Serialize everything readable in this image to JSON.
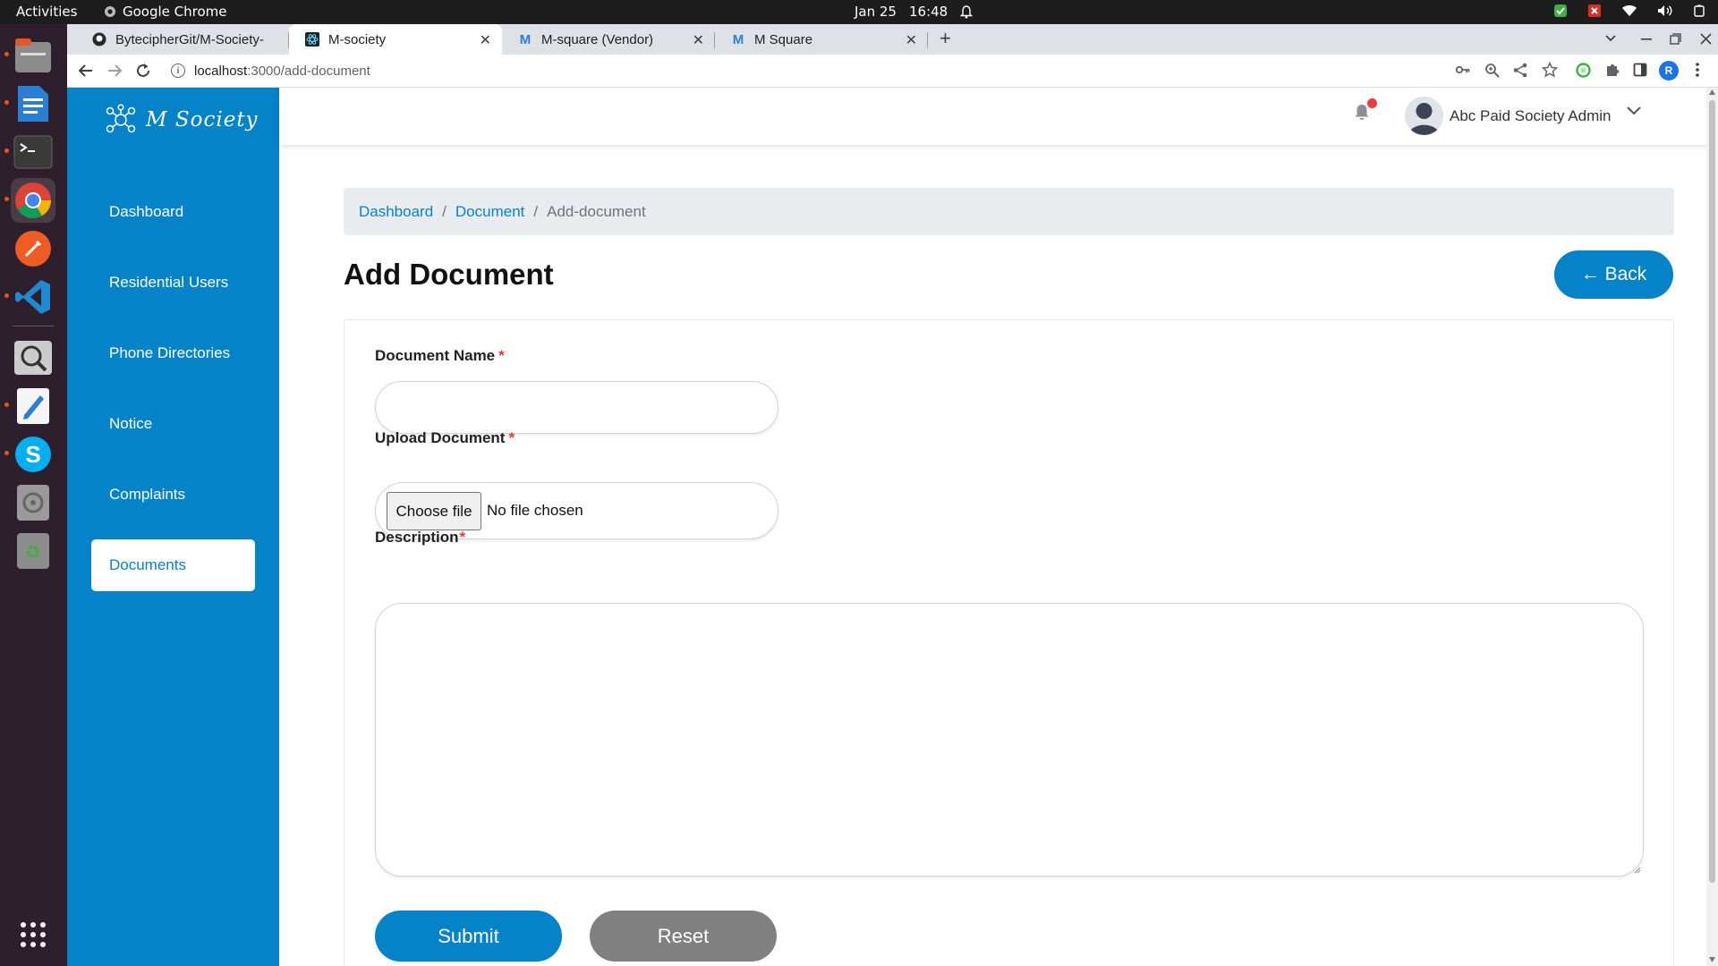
{
  "system_bar": {
    "activities": "Activities",
    "app_name": "Google Chrome",
    "date": "Jan 25",
    "time": "16:48"
  },
  "dock": {
    "items": [
      "files-icon",
      "writer-icon",
      "terminal-icon",
      "chrome-icon",
      "postman-icon",
      "vscode-icon",
      "image-viewer-icon",
      "text-editor-icon",
      "skype-icon",
      "disc-icon",
      "trash-icon",
      "app-grid-icon"
    ]
  },
  "browser": {
    "tabs": [
      {
        "title": "BytecipherGit/M-Society-",
        "icon": "github-icon"
      },
      {
        "title": "M-society",
        "icon": "react-icon",
        "active": true
      },
      {
        "title": "M-square (Vendor)",
        "icon": "m-logo-icon"
      },
      {
        "title": "M Square",
        "icon": "m-logo-icon"
      }
    ],
    "new_tab": "+",
    "url_host": "localhost",
    "url_path": ":3000/add-document",
    "profile_initial": "R"
  },
  "sidebar": {
    "brand": "M Society",
    "items": [
      {
        "label": "Dashboard"
      },
      {
        "label": "Residential Users"
      },
      {
        "label": "Phone Directories"
      },
      {
        "label": "Notice"
      },
      {
        "label": "Complaints"
      },
      {
        "label": "Documents",
        "active": true
      }
    ]
  },
  "header": {
    "user_name": "Abc Paid Society Admin",
    "has_notification": true
  },
  "breadcrumb": {
    "items": [
      "Dashboard",
      "Document"
    ],
    "current": "Add-document",
    "separator": "/"
  },
  "main": {
    "title": "Add Document",
    "back_label": "← Back"
  },
  "form": {
    "document_name_label": "Document Name",
    "document_name_value": "",
    "upload_label": "Upload Document",
    "choose_file_label": "Choose file",
    "no_file_text": "No file chosen",
    "description_label": "Description",
    "description_value": "",
    "required_mark": "*",
    "submit_label": "Submit",
    "reset_label": "Reset"
  },
  "colors": {
    "primary": "#0583c8",
    "reset": "#808080",
    "required": "#e53935",
    "breadcrumb_bg": "#e9ecef"
  }
}
